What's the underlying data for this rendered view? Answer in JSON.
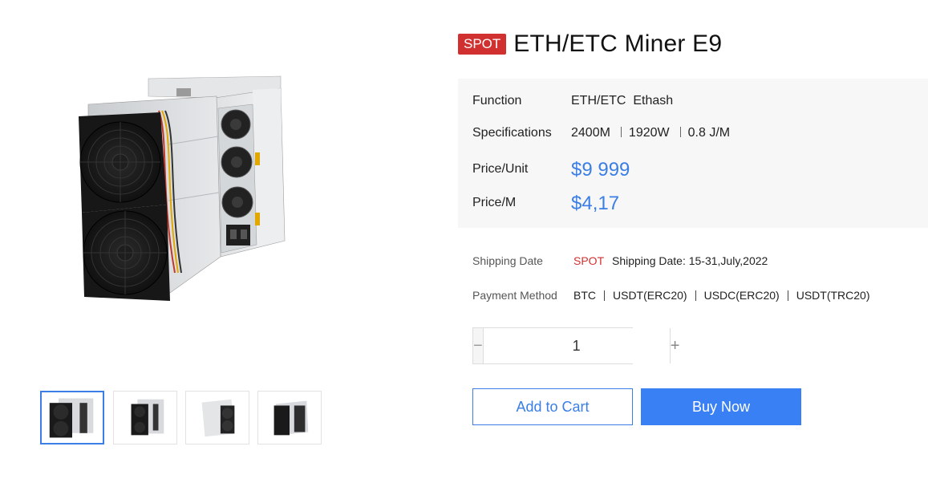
{
  "product": {
    "tag": "SPOT",
    "title": "ETH/ETC Miner E9"
  },
  "specs": {
    "function_label": "Function",
    "function_value": "ETH/ETC  Ethash",
    "specifications_label": "Specifications",
    "specifications_values": [
      "2400M",
      "1920W",
      "0.8 J/M"
    ],
    "price_unit_label": "Price/Unit",
    "price_unit_value": "$9 999",
    "price_m_label": "Price/M",
    "price_m_value": "$4,17"
  },
  "shipping": {
    "label": "Shipping Date",
    "tag": "SPOT",
    "text": "Shipping Date: 15-31,July,2022"
  },
  "payment": {
    "label": "Payment Method",
    "methods": [
      "BTC",
      "USDT(ERC20)",
      "USDC(ERC20)",
      "USDT(TRC20)"
    ]
  },
  "quantity": {
    "minus": "−",
    "value": "1",
    "plus": "+"
  },
  "actions": {
    "add_to_cart": "Add to Cart",
    "buy_now": "Buy Now"
  },
  "gallery": {
    "selected_index": 0,
    "thumbnail_count": 4
  },
  "colors": {
    "accent": "#3a7ee6",
    "spot_red": "#d0302f",
    "spec_bg": "#f7f7f7"
  }
}
